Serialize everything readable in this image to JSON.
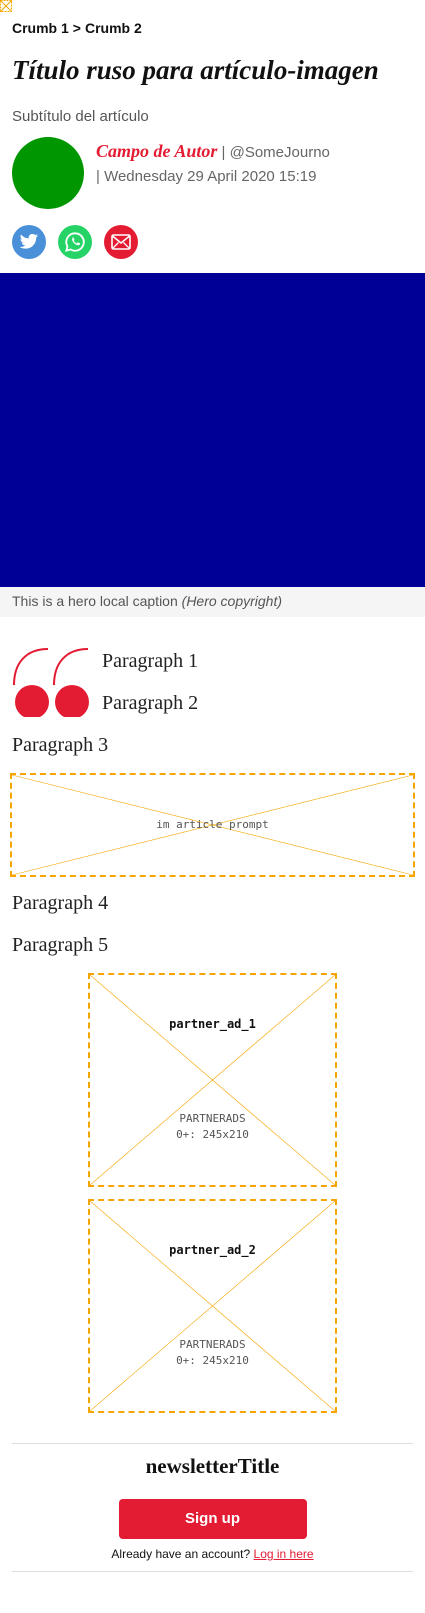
{
  "breadcrumbs": {
    "crumb1": "Crumb 1",
    "separator": ">",
    "crumb2": "Crumb 2"
  },
  "article": {
    "title": "Título ruso para artículo-imagen",
    "subtitle": "Subtítulo del artículo",
    "author": "Campo de Autor",
    "handle": "@SomeJourno",
    "date": "Wednesday 29 April 2020 15:19",
    "separator": "|"
  },
  "share": {
    "icons": [
      "twitter-icon",
      "whatsapp-icon",
      "email-icon"
    ],
    "colors": {
      "twitter": "#4a90d9",
      "whatsapp": "#25d366",
      "email": "#e31b33"
    }
  },
  "hero": {
    "caption": "This is a hero local caption",
    "copyright": "(Hero copyright)",
    "color": "#000096"
  },
  "body": {
    "p1": "Paragraph 1",
    "p2": "Paragraph 2",
    "p3": "Paragraph 3",
    "p4": "Paragraph 4",
    "p5": "Paragraph 5"
  },
  "ads": {
    "prompt": "im article prompt",
    "partner1": {
      "title": "partner_ad_1",
      "line1": "PARTNERADS",
      "line2": "0+: 245x210"
    },
    "partner2": {
      "title": "partner_ad_2",
      "line1": "PARTNERADS",
      "line2": "0+: 245x210"
    }
  },
  "newsletter": {
    "title": "newsletterTitle",
    "signup": "Sign up",
    "account_text": "Already have an account?",
    "login_link": "Log in here"
  },
  "colors": {
    "accent": "#e31b33",
    "avatar": "#009600",
    "ad_border": "#f5a500"
  }
}
